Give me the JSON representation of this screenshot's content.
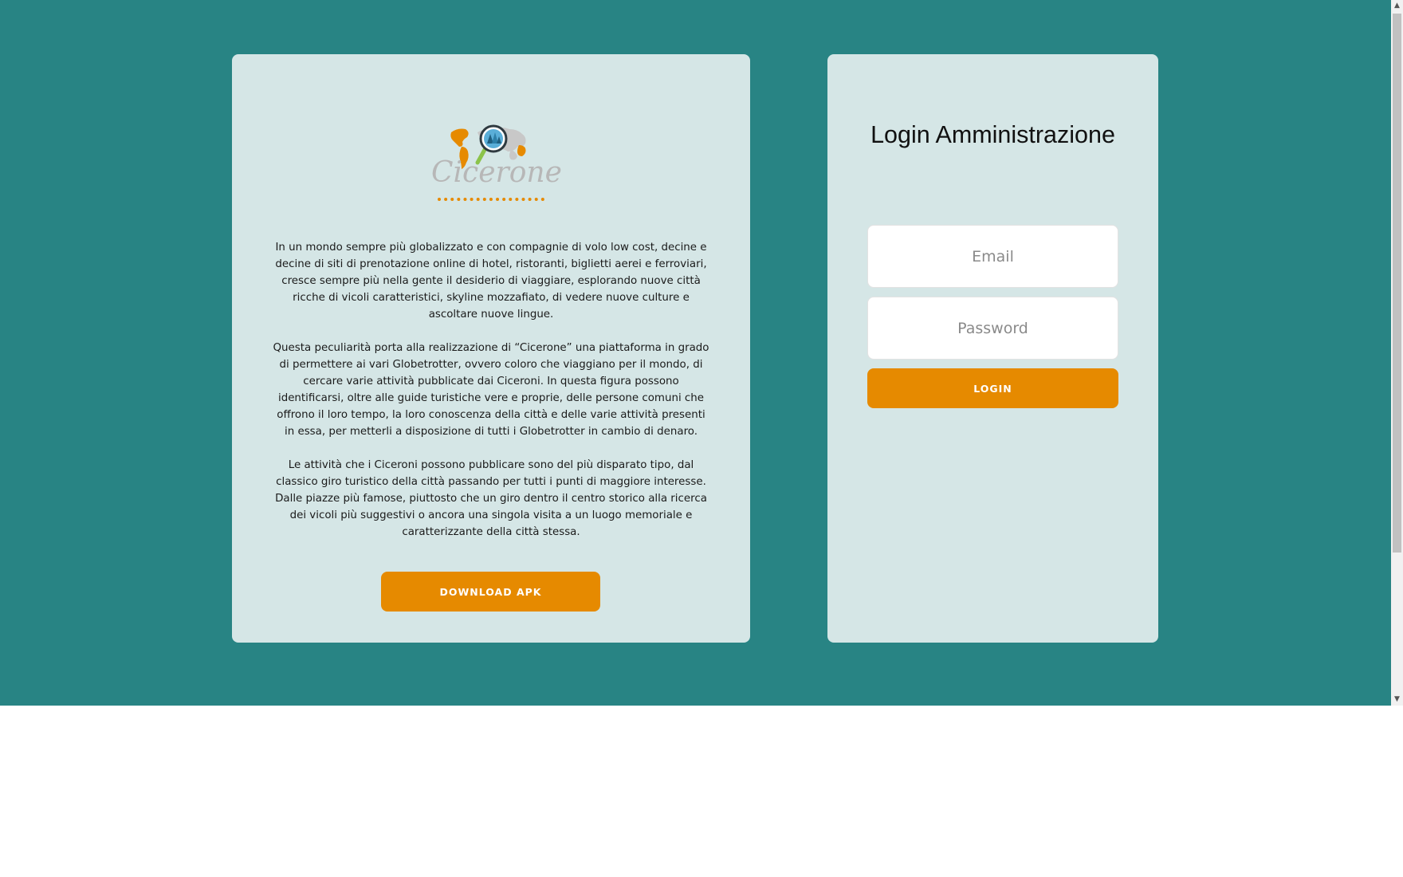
{
  "brand": {
    "logo_text": "Cicerone",
    "colors": {
      "background": "#288484",
      "card": "#d5e6e6",
      "accent": "#e68a00"
    }
  },
  "info": {
    "paragraphs": [
      "In un mondo sempre più globalizzato e con compagnie di volo low cost, decine e decine di siti di prenotazione online di hotel, ristoranti, biglietti aerei e ferroviari, cresce sempre più nella gente il desiderio di viaggiare, esplorando nuove città ricche di vicoli caratteristici, skyline mozzafiato, di vedere nuove culture e ascoltare nuove lingue.",
      "Questa peculiarità porta alla realizzazione di “Cicerone” una piattaforma in grado di permettere ai vari Globetrotter, ovvero coloro che viaggiano per il mondo, di cercare varie attività pubblicate dai Ciceroni. In questa figura possono identificarsi, oltre alle guide turistiche vere e proprie, delle persone comuni che offrono il loro tempo, la loro conoscenza della città e delle varie attività presenti in essa, per metterli a disposizione di tutti i Globetrotter in cambio di denaro.",
      "Le attività che i Ciceroni possono pubblicare sono del più disparato tipo, dal classico giro turistico della città passando per tutti i punti di maggiore interesse. Dalle piazze più famose, piuttosto che un giro dentro il centro storico alla ricerca dei vicoli più suggestivi o ancora una singola visita a un luogo memoriale e caratterizzante della città stessa."
    ],
    "download_label": "DOWNLOAD APK"
  },
  "login": {
    "title": "Login Amministrazione",
    "email_placeholder": "Email",
    "password_placeholder": "Password",
    "submit_label": "LOGIN"
  },
  "icons": {
    "logo": "world-map-magnifier-logo",
    "scroll_up": "chevron-up-icon",
    "scroll_down": "chevron-down-icon"
  }
}
